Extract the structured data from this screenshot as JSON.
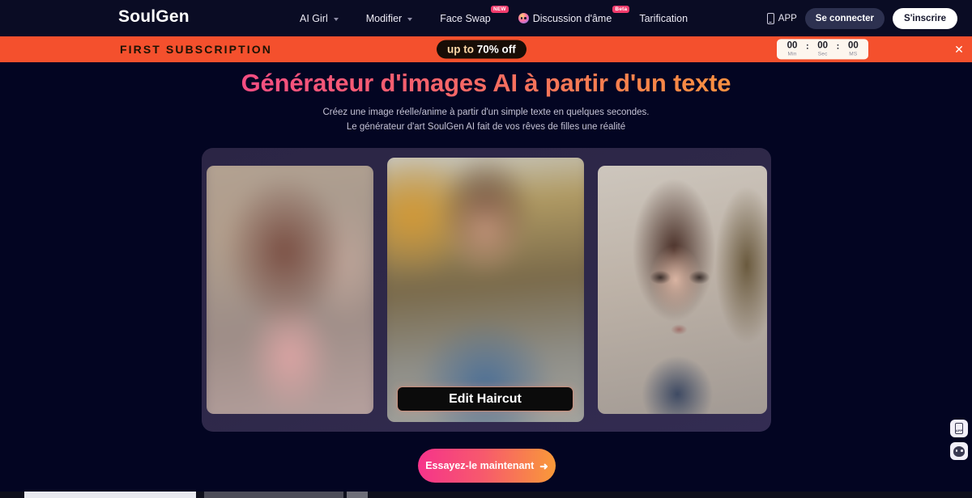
{
  "brand": {
    "name": "SoulGen"
  },
  "nav": {
    "items": [
      {
        "label": "AI Girl",
        "caret": true,
        "badge": null,
        "icon": null
      },
      {
        "label": "Modifier",
        "caret": true,
        "badge": null,
        "icon": null
      },
      {
        "label": "Face Swap",
        "caret": false,
        "badge": "NEW",
        "icon": null
      },
      {
        "label": "Discussion d'âme",
        "caret": false,
        "badge": "Beta",
        "icon": "soul-chat-icon"
      },
      {
        "label": "Tarification",
        "caret": false,
        "badge": null,
        "icon": null
      }
    ],
    "app_label": "APP",
    "login_label": "Se connecter",
    "signup_label": "S'inscrire"
  },
  "promo": {
    "title": "FIRST SUBSCRIPTION",
    "offer_prefix": "up to ",
    "offer_value": "70% off",
    "timer": {
      "minutes": "00",
      "seconds": "00",
      "ms": "00",
      "sep": ":",
      "minutes_label": "Min",
      "seconds_label": "Sec",
      "ms_label": "MS"
    },
    "close_glyph": "✕",
    "background_color": "#f4502d"
  },
  "hero": {
    "title": "Générateur d'images AI à partir d'un texte",
    "subtitle_line1": "Créez une image réelle/anime à partir d'un simple texte en quelques secondes.",
    "subtitle_line2": "Le générateur d'art SoulGen AI fait de vos rêves de filles une réalité",
    "title_gradient_from": "#f6338b",
    "title_gradient_to": "#fbb024"
  },
  "showcase": {
    "edit_button_label": "Edit Haircut",
    "card_background": "#2e2849"
  },
  "cta": {
    "label": "Essayez-le maintenant",
    "arrow": "➜",
    "gradient_from": "#f6338b",
    "gradient_to": "#f99a38"
  },
  "floating": {
    "app_label": "APP",
    "chat_label": "chat"
  }
}
